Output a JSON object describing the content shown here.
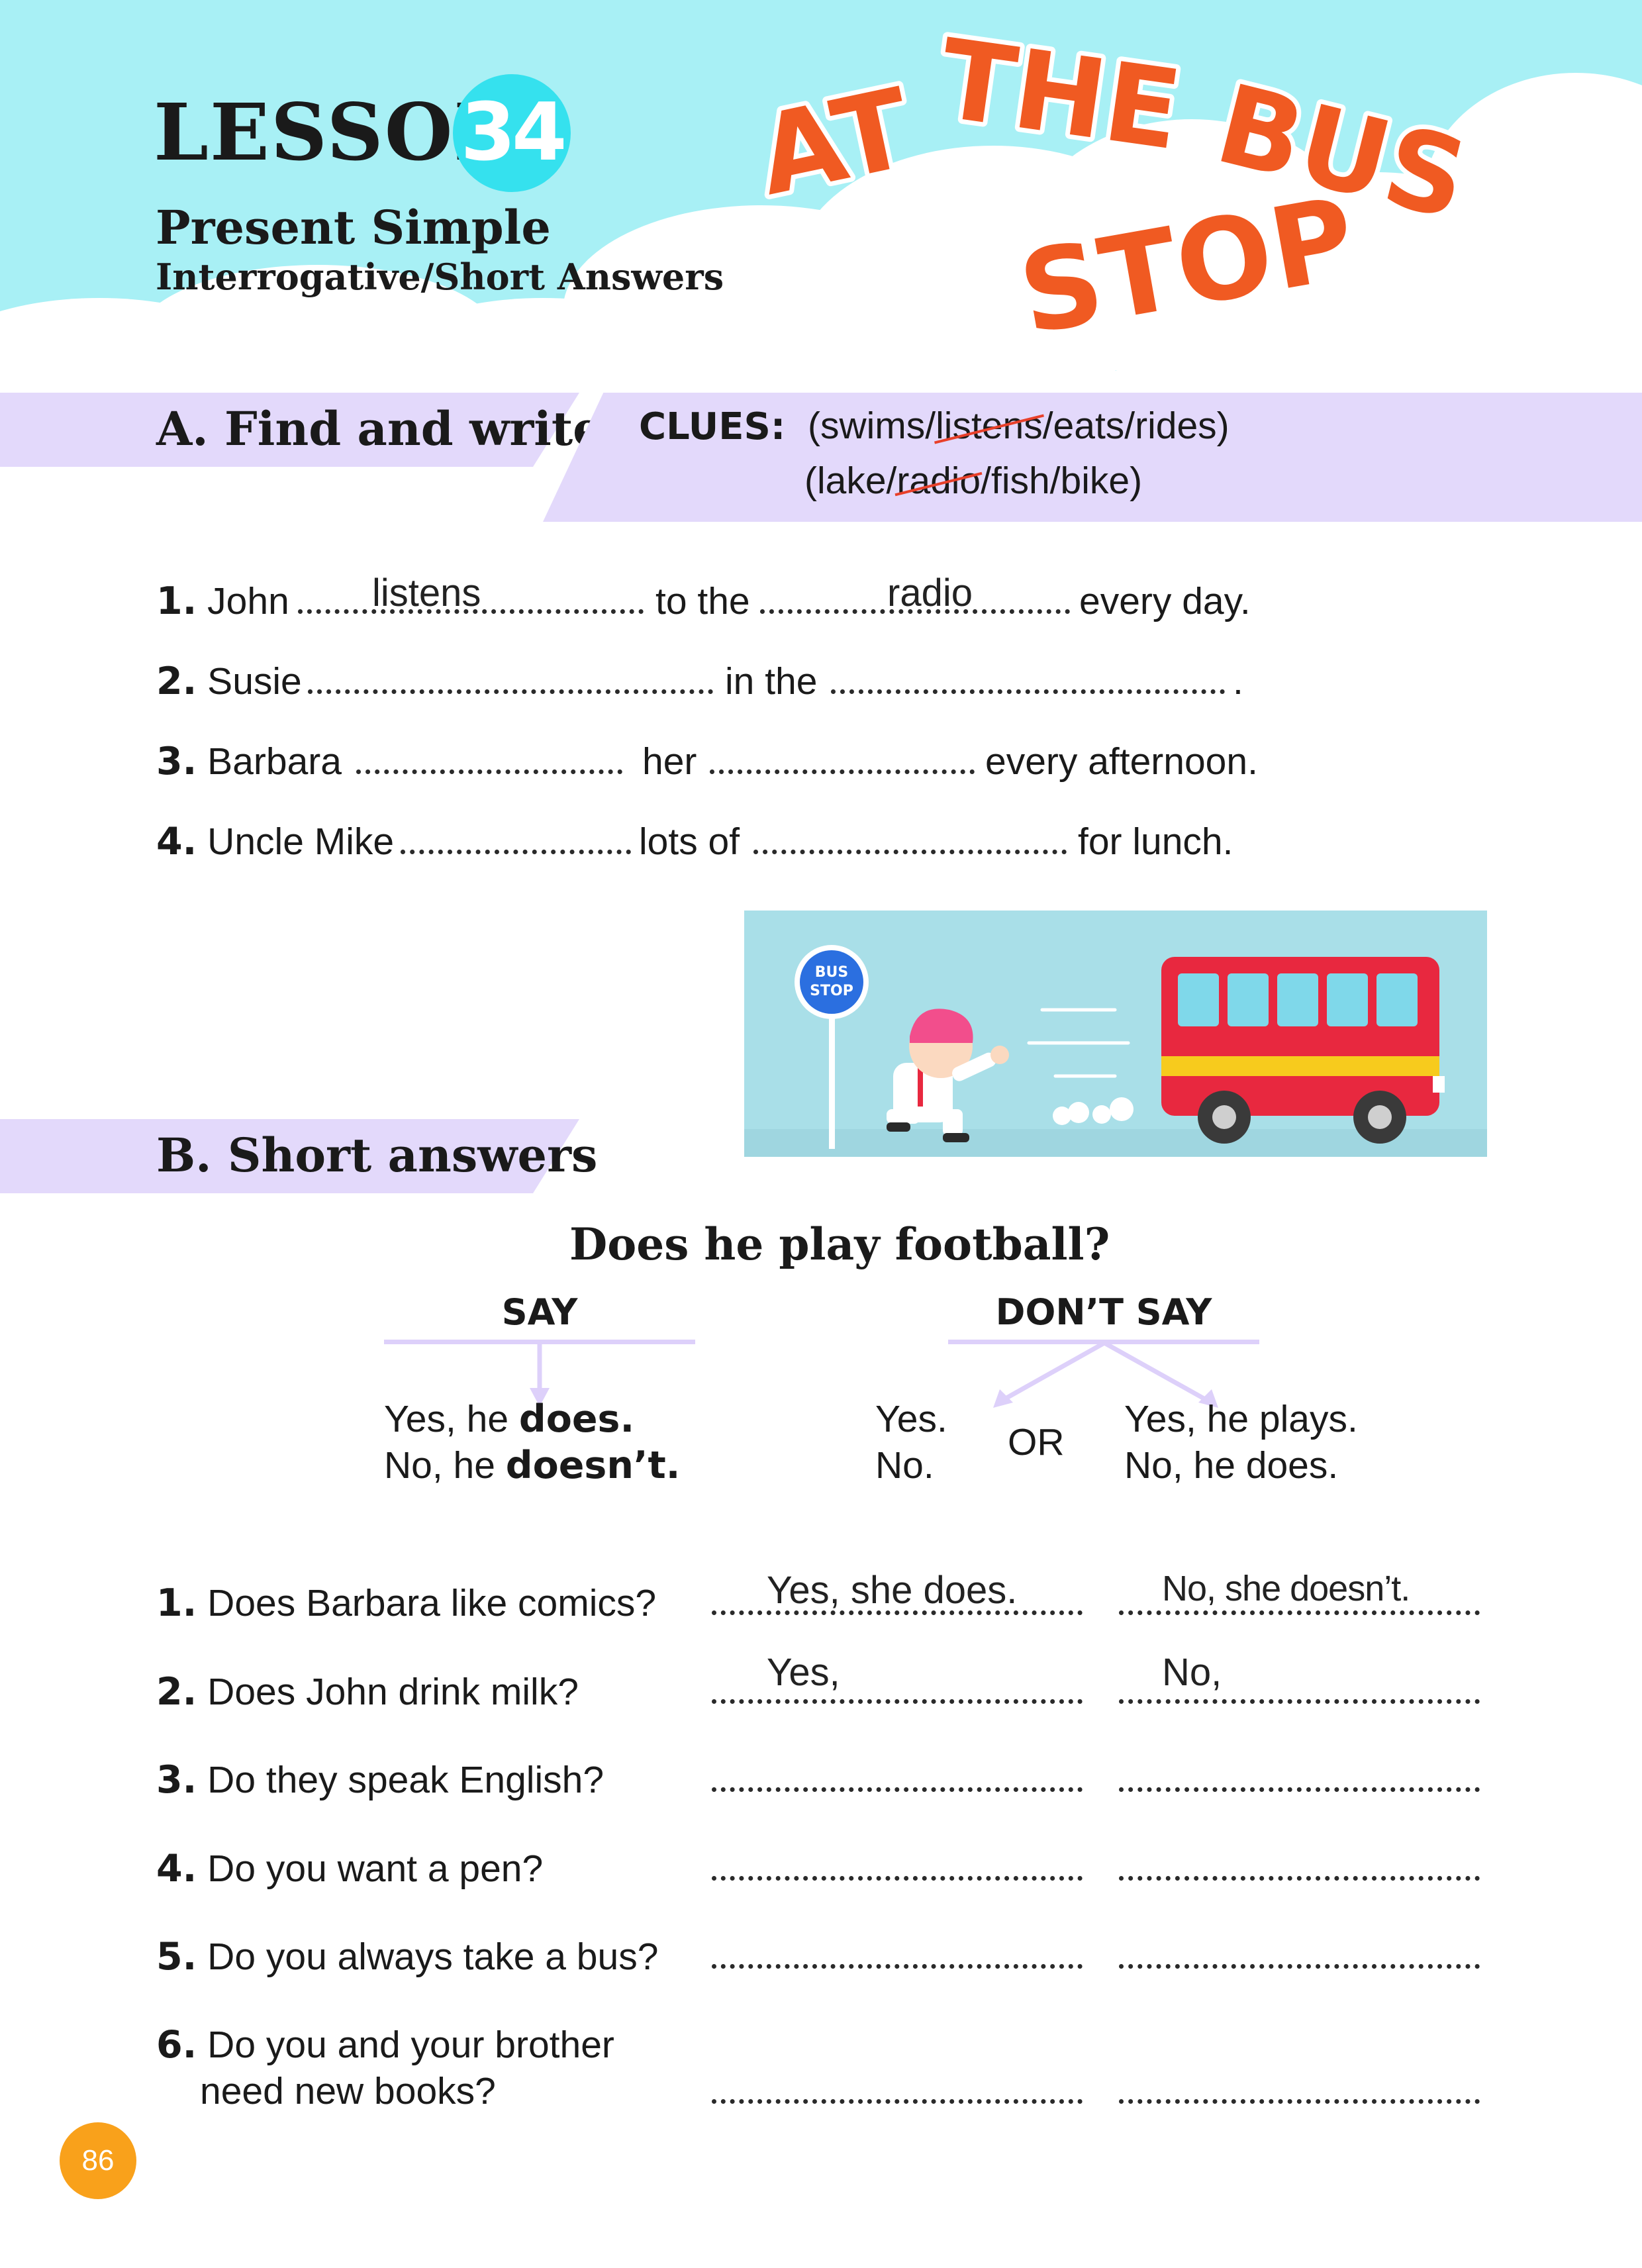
{
  "header": {
    "lesson_word": "LESSON",
    "lesson_number": "34",
    "grammar_title": "Present Simple",
    "grammar_subtitle": "Interrogative/Short Answers",
    "title_art_words": [
      "AT",
      "THE",
      "BUS",
      "STOP"
    ]
  },
  "section_a": {
    "title": "A. Find and write",
    "clues_label": "CLUES:",
    "clue_line_1": [
      "(swims/",
      "listens",
      "/eats/rides)"
    ],
    "clue_line_2": [
      "(lake/",
      "radio",
      "/fish/bike)"
    ],
    "crossed_out_clues": [
      "listens",
      "radio"
    ],
    "items": [
      {
        "number": "1.",
        "parts": [
          "John",
          "to the",
          "every day."
        ],
        "answers": [
          "listens",
          "radio"
        ]
      },
      {
        "number": "2.",
        "parts": [
          "Susie",
          "in the",
          "."
        ],
        "answers": [
          "",
          ""
        ]
      },
      {
        "number": "3.",
        "parts": [
          "Barbara",
          "her",
          "every afternoon."
        ],
        "answers": [
          "",
          ""
        ]
      },
      {
        "number": "4.",
        "parts": [
          "Uncle Mike",
          "lots of",
          "for lunch."
        ],
        "answers": [
          "",
          ""
        ]
      }
    ]
  },
  "illustration": {
    "sign_text": [
      "BUS",
      "STOP"
    ],
    "colors": {
      "background": "#a9dfe8",
      "bus": "#e8283f",
      "stripe": "#f7cb1d",
      "sign": "#2b6fe0"
    }
  },
  "section_b": {
    "title": "B. Short answers",
    "example_question": "Does he play football?",
    "say_label": "SAY",
    "dont_say_label": "DON’T SAY",
    "say_line_1": [
      "Yes, he ",
      "does."
    ],
    "say_line_2": [
      "No, he ",
      "doesn’t."
    ],
    "dont_say_left": [
      "Yes.",
      "No."
    ],
    "or_word": "OR",
    "dont_say_right": [
      "Yes, he plays.",
      "No, he does."
    ],
    "questions": [
      {
        "number": "1.",
        "text": [
          "Does Barbara like comics?"
        ],
        "yes_answer": "Yes, she does.",
        "no_answer": "No, she doesn’t."
      },
      {
        "number": "2.",
        "text": [
          "Does John drink milk?"
        ],
        "yes_answer": "Yes,",
        "no_answer": "No,"
      },
      {
        "number": "3.",
        "text": [
          "Do they speak English?"
        ],
        "yes_answer": "",
        "no_answer": ""
      },
      {
        "number": "4.",
        "text": [
          "Do you want a pen?"
        ],
        "yes_answer": "",
        "no_answer": ""
      },
      {
        "number": "5.",
        "text": [
          "Do you always take a bus?"
        ],
        "yes_answer": "",
        "no_answer": ""
      },
      {
        "number": "6.",
        "text": [
          "Do you and your brother",
          "need new books?"
        ],
        "yes_answer": "",
        "no_answer": ""
      }
    ]
  },
  "footer": {
    "page_number": "86"
  },
  "colors": {
    "sky": "#a8f0f5",
    "cloud": "#ffffff",
    "band": "#e3d9fb",
    "accent_orange": "#f05a22",
    "lesson_circle": "#35e1ee",
    "page_circle": "#f9a11b"
  }
}
